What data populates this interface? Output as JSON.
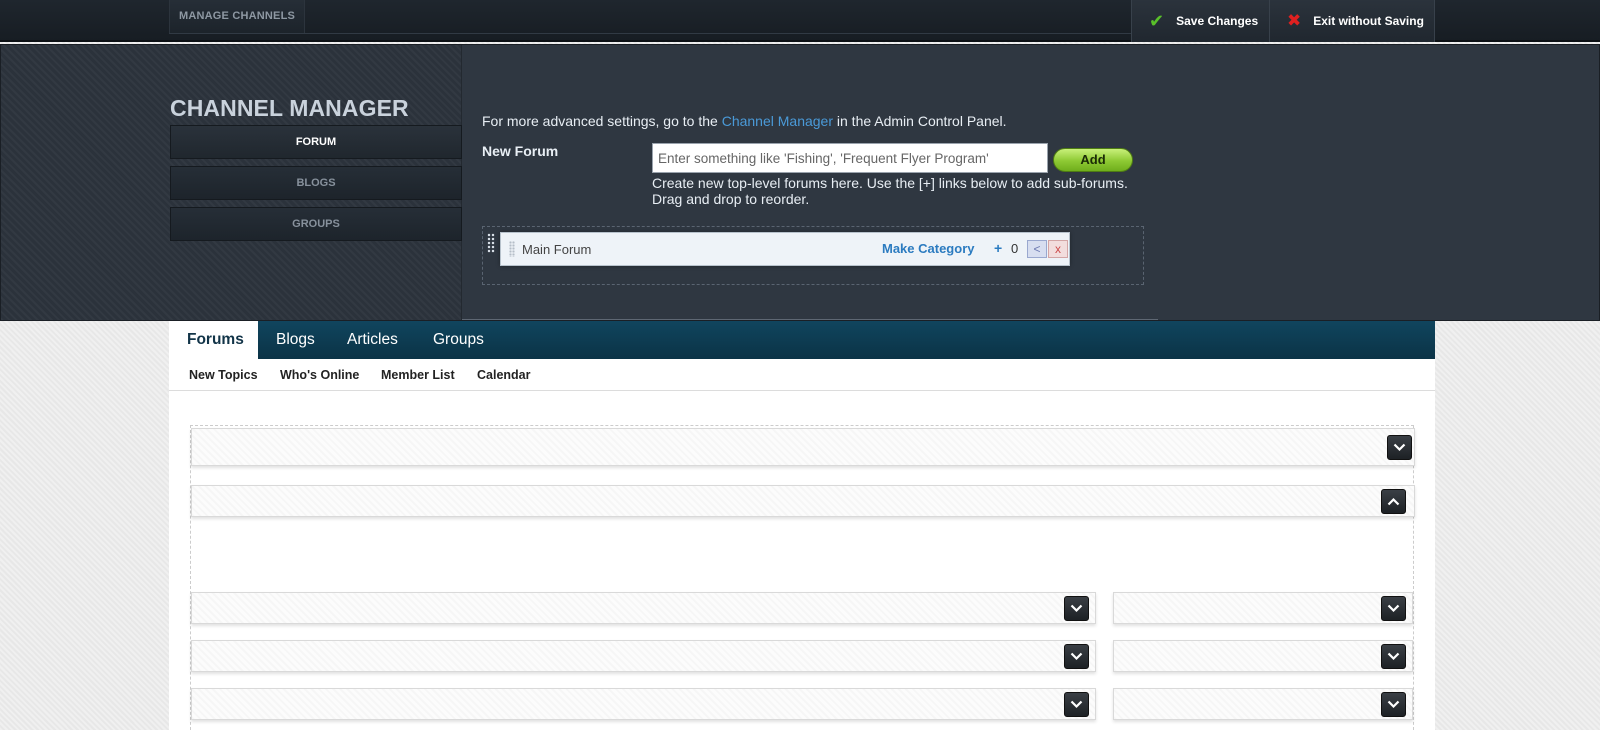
{
  "toolbar": {
    "manage_channels": "MANAGE CHANNELS",
    "save_label": "Save Changes",
    "exit_label": "Exit without Saving",
    "save_icon_color": "#59c02a",
    "exit_icon_color": "#e02020"
  },
  "channel_manager": {
    "title": "CHANNEL MANAGER",
    "sidebar": [
      {
        "label": "FORUM",
        "active": true
      },
      {
        "label": "BLOGS",
        "active": false
      },
      {
        "label": "GROUPS",
        "active": false
      }
    ],
    "advanced_prefix": "For more advanced settings, go to the ",
    "advanced_link": "Channel Manager",
    "advanced_suffix": " in the Admin Control Panel.",
    "new_forum_label": "New Forum",
    "new_forum_placeholder": "Enter something like 'Fishing', 'Frequent Flyer Program'",
    "add_label": "Add",
    "help_line1": "Create new top-level forums here. Use the [+] links below to add sub-forums.",
    "help_line2": "Drag and drop to reorder.",
    "forums": [
      {
        "name": "Main Forum",
        "make_category": "Make Category",
        "plus": "+",
        "count": "0",
        "indent": "<",
        "delete": "x"
      }
    ],
    "link_color": "#4a9ad8",
    "add_button_color": "#8dc933"
  },
  "nav": {
    "tabs": [
      {
        "label": "Forums",
        "active": true
      },
      {
        "label": "Blogs",
        "active": false
      },
      {
        "label": "Articles",
        "active": false
      },
      {
        "label": "Groups",
        "active": false
      }
    ],
    "subnav": [
      "New Topics",
      "Who's Online",
      "Member List",
      "Calendar"
    ],
    "navbar_color": "#0f4159"
  },
  "widgets": {
    "icons": [
      "chevron-down-icon",
      "chevron-up-icon"
    ]
  }
}
